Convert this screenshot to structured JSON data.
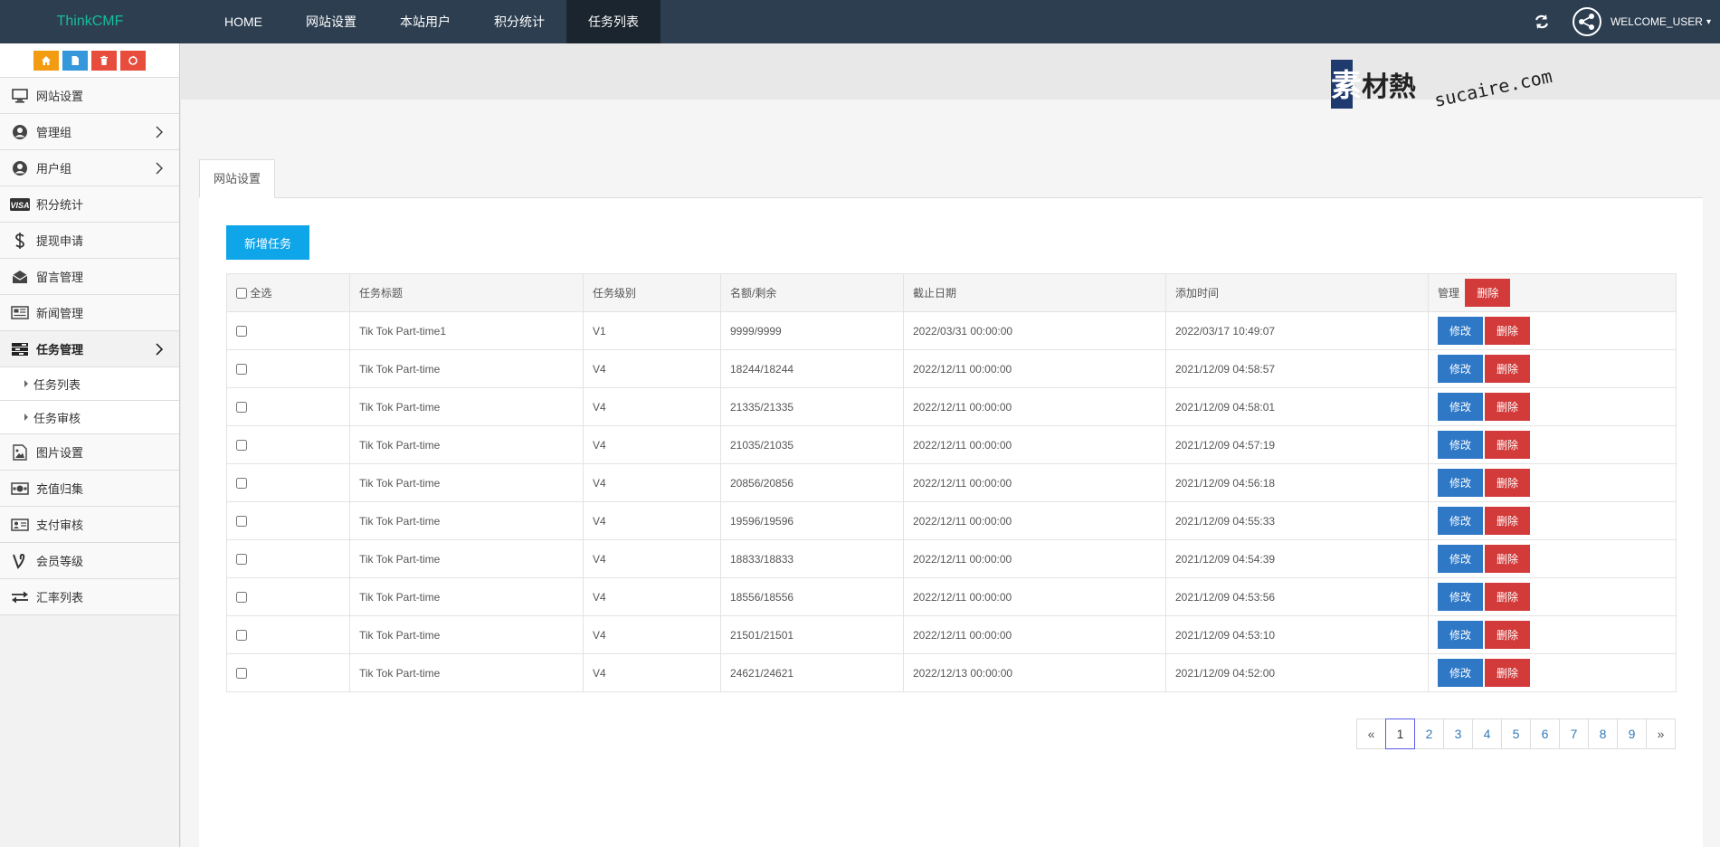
{
  "brand": "ThinkCMF",
  "topnav": [
    "HOME",
    "网站设置",
    "本站用户",
    "积分统计",
    "任务列表"
  ],
  "active_topnav": "任务列表",
  "user": {
    "name": "WELCOME_USER",
    "caret": "▾"
  },
  "sidebar": {
    "shortcuts": [
      {
        "icon": "home-icon",
        "color": "#f39c12"
      },
      {
        "icon": "file-icon",
        "color": "#3498db"
      },
      {
        "icon": "trash-icon",
        "color": "#e74c3c"
      },
      {
        "icon": "recycle-icon",
        "color": "#e74c3c"
      }
    ],
    "items": [
      {
        "label": "网站设置",
        "icon": "monitor-icon"
      },
      {
        "label": "管理组",
        "icon": "user-circle-icon"
      },
      {
        "label": "用户组",
        "icon": "user-circle-icon"
      },
      {
        "label": "积分统计",
        "icon": "visa-icon"
      },
      {
        "label": "提现申请",
        "icon": "dollar-icon"
      },
      {
        "label": "留言管理",
        "icon": "envelope-open-icon"
      },
      {
        "label": "新闻管理",
        "icon": "newspaper-icon"
      },
      {
        "label": "任务管理",
        "icon": "tasks-icon"
      },
      {
        "label": "任务列表",
        "icon": "caret-right-icon"
      },
      {
        "label": "任务审核",
        "icon": "caret-right-icon"
      },
      {
        "label": "图片设置",
        "icon": "image-icon"
      },
      {
        "label": "充值归集",
        "icon": "money-icon"
      },
      {
        "label": "支付审核",
        "icon": "id-card-icon"
      },
      {
        "label": "会员等级",
        "icon": "vine-icon"
      },
      {
        "label": "汇率列表",
        "icon": "exchange-icon"
      }
    ]
  },
  "watermark": {
    "cn": "素材熱",
    "en": "sucaire.com"
  },
  "tab_label": "网站设置",
  "add_button": "新增任务",
  "table": {
    "select_all": "全选",
    "headers": [
      "任务标题",
      "任务级别",
      "名额/剩余",
      "截止日期",
      "添加时间",
      "管理"
    ],
    "header_delete": "删除",
    "edit_label": "修改",
    "delete_label": "删除",
    "rows": [
      {
        "title": "Tik Tok Part-time1",
        "level": "V1",
        "quota": "9999/9999",
        "deadline": "2022/03/31 00:00:00",
        "added": "2022/03/17 10:49:07"
      },
      {
        "title": "Tik Tok Part-time",
        "level": "V4",
        "quota": "18244/18244",
        "deadline": "2022/12/11 00:00:00",
        "added": "2021/12/09 04:58:57"
      },
      {
        "title": "Tik Tok Part-time",
        "level": "V4",
        "quota": "21335/21335",
        "deadline": "2022/12/11 00:00:00",
        "added": "2021/12/09 04:58:01"
      },
      {
        "title": "Tik Tok Part-time",
        "level": "V4",
        "quota": "21035/21035",
        "deadline": "2022/12/11 00:00:00",
        "added": "2021/12/09 04:57:19"
      },
      {
        "title": "Tik Tok Part-time",
        "level": "V4",
        "quota": "20856/20856",
        "deadline": "2022/12/11 00:00:00",
        "added": "2021/12/09 04:56:18"
      },
      {
        "title": "Tik Tok Part-time",
        "level": "V4",
        "quota": "19596/19596",
        "deadline": "2022/12/11 00:00:00",
        "added": "2021/12/09 04:55:33"
      },
      {
        "title": "Tik Tok Part-time",
        "level": "V4",
        "quota": "18833/18833",
        "deadline": "2022/12/11 00:00:00",
        "added": "2021/12/09 04:54:39"
      },
      {
        "title": "Tik Tok Part-time",
        "level": "V4",
        "quota": "18556/18556",
        "deadline": "2022/12/11 00:00:00",
        "added": "2021/12/09 04:53:56"
      },
      {
        "title": "Tik Tok Part-time",
        "level": "V4",
        "quota": "21501/21501",
        "deadline": "2022/12/11 00:00:00",
        "added": "2021/12/09 04:53:10"
      },
      {
        "title": "Tik Tok Part-time",
        "level": "V4",
        "quota": "24621/24621",
        "deadline": "2022/12/13 00:00:00",
        "added": "2021/12/09 04:52:00"
      }
    ]
  },
  "pagination": {
    "prev": "«",
    "pages": [
      "1",
      "2",
      "3",
      "4",
      "5",
      "6",
      "7",
      "8",
      "9"
    ],
    "next": "»",
    "current": "1"
  }
}
